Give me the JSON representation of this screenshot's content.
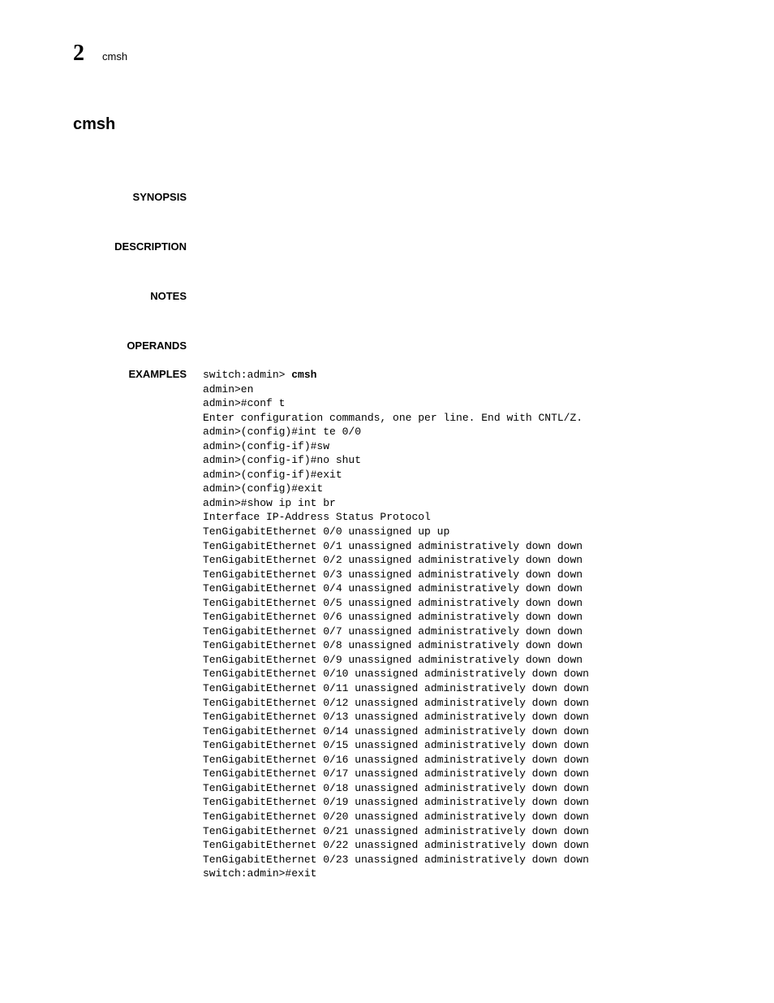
{
  "header": {
    "chapter": "2",
    "cmd": "cmsh"
  },
  "title": "cmsh",
  "sections": {
    "synopsis": "SYNOPSIS",
    "description": "DESCRIPTION",
    "notes": "NOTES",
    "operands": "OPERANDS",
    "examples": "EXAMPLES"
  },
  "example": {
    "prompt_line_prefix": "switch:admin> ",
    "prompt_cmd": "cmsh",
    "lines": [
      "admin>en",
      "admin>#conf t",
      "Enter configuration commands, one per line. End with CNTL/Z.",
      "admin>(config)#int te 0/0",
      "admin>(config-if)#sw",
      "admin>(config-if)#no shut",
      "admin>(config-if)#exit",
      "admin>(config)#exit",
      "admin>#show ip int br",
      "Interface IP-Address Status Protocol",
      "TenGigabitEthernet 0/0 unassigned up up",
      "TenGigabitEthernet 0/1 unassigned administratively down down",
      "TenGigabitEthernet 0/2 unassigned administratively down down",
      "TenGigabitEthernet 0/3 unassigned administratively down down",
      "TenGigabitEthernet 0/4 unassigned administratively down down",
      "TenGigabitEthernet 0/5 unassigned administratively down down",
      "TenGigabitEthernet 0/6 unassigned administratively down down",
      "TenGigabitEthernet 0/7 unassigned administratively down down",
      "TenGigabitEthernet 0/8 unassigned administratively down down",
      "TenGigabitEthernet 0/9 unassigned administratively down down",
      "TenGigabitEthernet 0/10 unassigned administratively down down",
      "TenGigabitEthernet 0/11 unassigned administratively down down",
      "TenGigabitEthernet 0/12 unassigned administratively down down",
      "TenGigabitEthernet 0/13 unassigned administratively down down",
      "TenGigabitEthernet 0/14 unassigned administratively down down",
      "TenGigabitEthernet 0/15 unassigned administratively down down",
      "TenGigabitEthernet 0/16 unassigned administratively down down",
      "TenGigabitEthernet 0/17 unassigned administratively down down",
      "TenGigabitEthernet 0/18 unassigned administratively down down",
      "TenGigabitEthernet 0/19 unassigned administratively down down",
      "TenGigabitEthernet 0/20 unassigned administratively down down",
      "TenGigabitEthernet 0/21 unassigned administratively down down",
      "TenGigabitEthernet 0/22 unassigned administratively down down",
      "TenGigabitEthernet 0/23 unassigned administratively down down",
      "switch:admin>#exit"
    ]
  }
}
